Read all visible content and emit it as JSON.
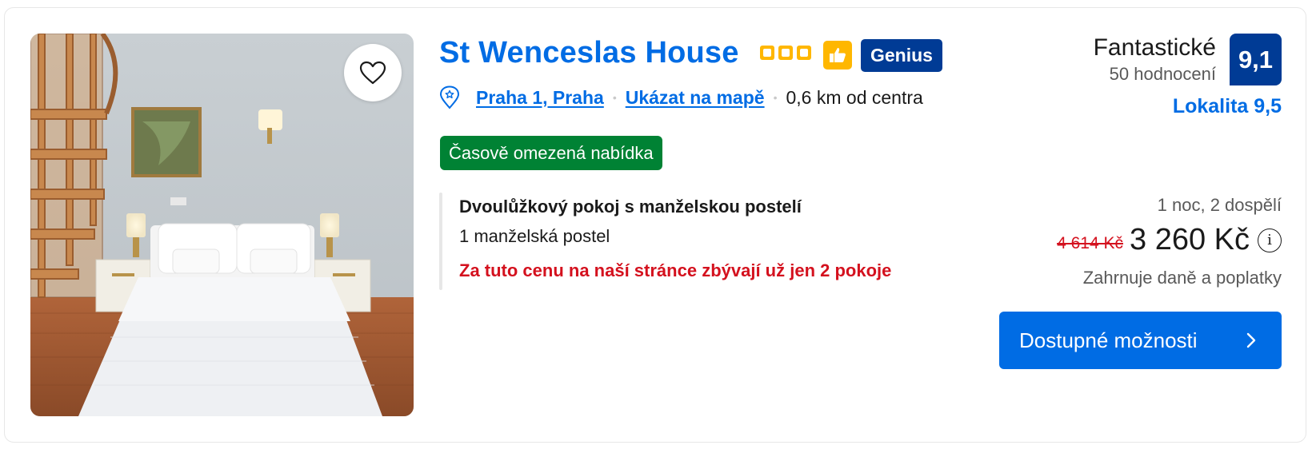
{
  "property": {
    "name": "St Wenceslas House",
    "star_count": 3,
    "genius_label": "Genius",
    "location_link": "Praha 1, Praha",
    "map_link": "Ukázat na mapě",
    "distance": "0,6 km od centra",
    "offer_badge": "Časově omezená nabídka"
  },
  "room": {
    "name": "Dvoulůžkový pokoj s manželskou postelí",
    "bed": "1 manželská postel",
    "scarcity": "Za tuto cenu na naší stránce zbývají už jen 2 pokoje"
  },
  "rating": {
    "word": "Fantastické",
    "reviews": "50 hodnocení",
    "score": "9,1",
    "location_score": "Lokalita 9,5"
  },
  "price": {
    "stay": "1 noc, 2 dospělí",
    "old": "4 614 Kč",
    "current": "3 260 Kč",
    "info_glyph": "i",
    "taxes": "Zahrnuje daně a poplatky",
    "cta": "Dostupné možnosti"
  },
  "colors": {
    "brand_blue": "#006ce4",
    "dark_blue": "#003b95",
    "star_yellow": "#ffb700",
    "offer_green": "#008234",
    "alert_red": "#d4111e"
  },
  "icons": [
    "heart-icon",
    "star-icon",
    "thumbs-up-icon",
    "map-pin-icon",
    "info-icon",
    "chevron-right-icon"
  ]
}
